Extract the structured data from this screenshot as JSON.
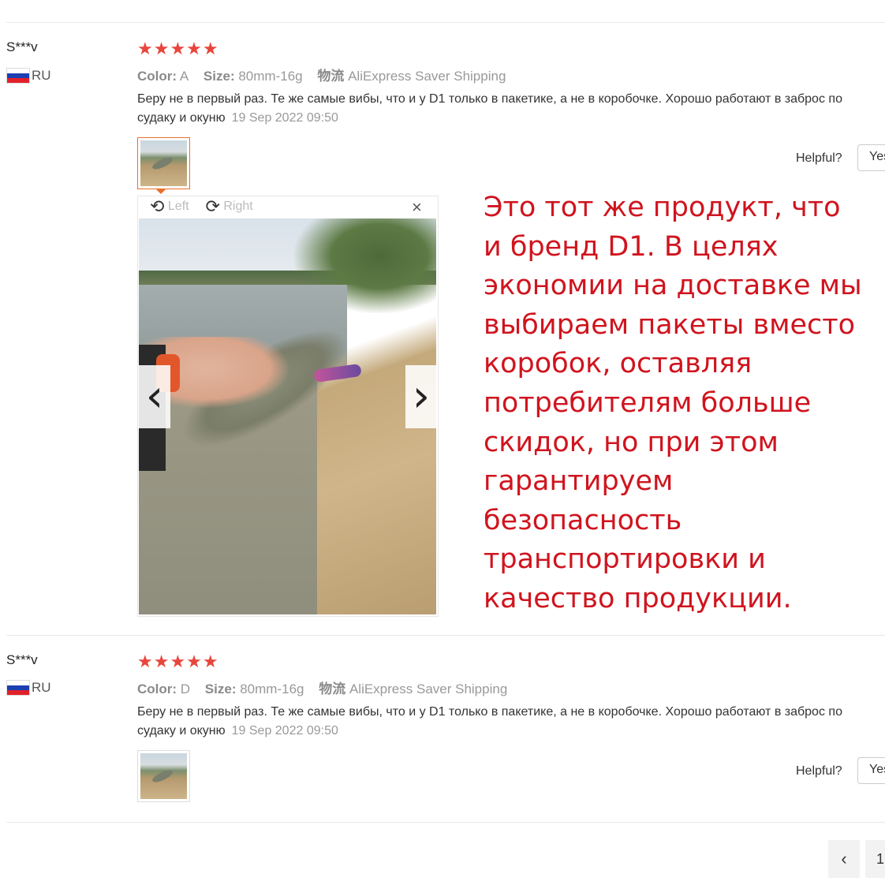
{
  "reviews": [
    {
      "username": "S***v",
      "country": "RU",
      "stars": "★★★★★",
      "color_label": "Color:",
      "color_value": "A",
      "size_label": "Size:",
      "size_value": "80mm-16g",
      "shipping_label": "物流",
      "shipping_value": "AliExpress Saver Shipping",
      "text": "Беру не в первый раз. Те же самые вибы, что и у D1 только в пакетике, а не в коробочке. Хорошо работают в заброс по судаку и окуню",
      "date": "19 Sep 2022 09:50",
      "helpful_label": "Helpful?",
      "yes_label": "Yes"
    },
    {
      "username": "S***v",
      "country": "RU",
      "stars": "★★★★★",
      "color_label": "Color:",
      "color_value": "D",
      "size_label": "Size:",
      "size_value": "80mm-16g",
      "shipping_label": "物流",
      "shipping_value": "AliExpress Saver Shipping",
      "text": "Беру не в первый раз. Те же самые вибы, что и у D1 только в пакетике, а не в коробочке. Хорошо работают в заброс по судаку и окуню",
      "date": "19 Sep 2022 09:50",
      "helpful_label": "Helpful?",
      "yes_label": "Yes"
    }
  ],
  "viewer": {
    "left_label": "Left",
    "right_label": "Right",
    "close_glyph": "×",
    "prev_glyph": "‹",
    "next_glyph": "›"
  },
  "annotation": "Это тот же продукт, что и бренд D1. В целях экономии на доставке мы выбираем пакеты вместо коробок, оставляя потребителям больше скидок, но при этом гарантируем безопасность транспортировки и качество продукции.",
  "pagination": {
    "prev_glyph": "‹",
    "current_page": "1"
  },
  "colors": {
    "star": "#e8453c",
    "annotation": "#d0141e",
    "thumb_active_border": "#e8702a"
  }
}
